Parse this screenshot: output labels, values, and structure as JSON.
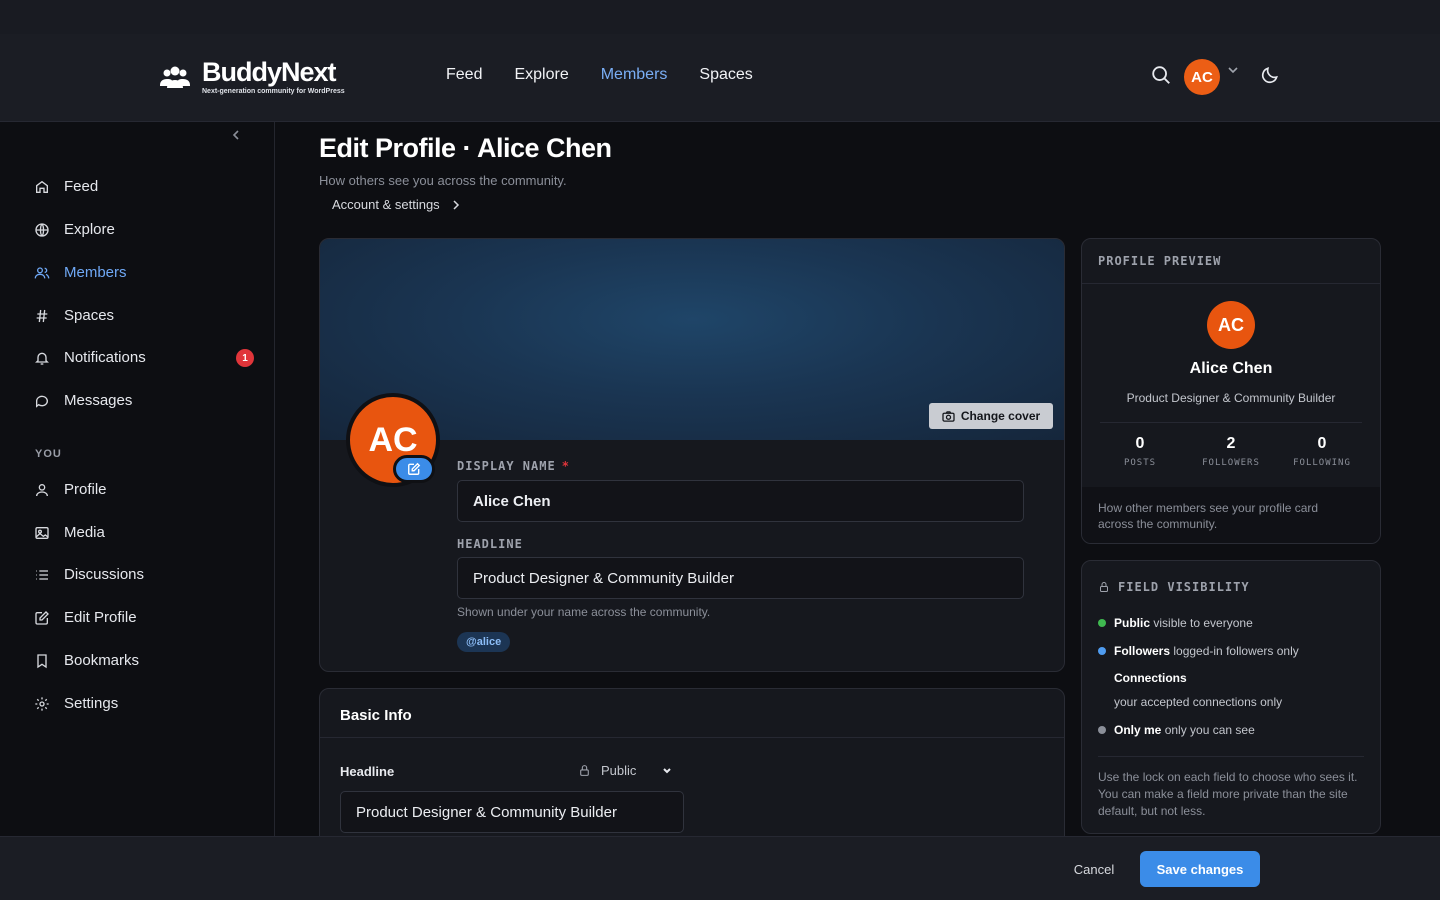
{
  "brand": {
    "name": "BuddyNext",
    "tagline": "Next-generation community for WordPress",
    "accent": "#3b8ce8",
    "avatar_color": "#e8550f"
  },
  "topnav": [
    {
      "label": "Feed",
      "active": false
    },
    {
      "label": "Explore",
      "active": false
    },
    {
      "label": "Members",
      "active": true
    },
    {
      "label": "Spaces",
      "active": false
    }
  ],
  "user": {
    "initials": "AC"
  },
  "sidebar": {
    "main": [
      {
        "label": "Feed",
        "icon": "home-icon"
      },
      {
        "label": "Explore",
        "icon": "globe-icon"
      },
      {
        "label": "Members",
        "icon": "users-icon",
        "active": true
      },
      {
        "label": "Spaces",
        "icon": "hash-icon"
      },
      {
        "label": "Notifications",
        "icon": "bell-icon",
        "badge": "1"
      },
      {
        "label": "Messages",
        "icon": "chat-icon"
      }
    ],
    "section_label": "YOU",
    "you": [
      {
        "label": "Profile",
        "icon": "user-icon"
      },
      {
        "label": "Media",
        "icon": "image-icon"
      },
      {
        "label": "Discussions",
        "icon": "list-icon"
      },
      {
        "label": "Edit Profile",
        "icon": "edit-icon"
      },
      {
        "label": "Bookmarks",
        "icon": "bookmark-icon"
      },
      {
        "label": "Settings",
        "icon": "gear-icon"
      }
    ]
  },
  "page": {
    "title": "Edit Profile · Alice Chen",
    "subtitle": "How others see you across the community.",
    "breadcrumb": "Account & settings"
  },
  "profile_card": {
    "change_cover": "Change cover",
    "initials": "AC",
    "display_name_label": "DISPLAY NAME",
    "required_mark": "*",
    "display_name": "Alice Chen",
    "headline_label": "HEADLINE",
    "headline": "Product Designer & Community Builder",
    "headline_hint": "Shown under your name across the community.",
    "handle": "@alice"
  },
  "basic_info": {
    "title": "Basic Info",
    "field_label": "Headline",
    "visibility": "Public",
    "value": "Product Designer & Community Builder"
  },
  "preview": {
    "label": "PROFILE PREVIEW",
    "initials": "AC",
    "name": "Alice Chen",
    "headline": "Product Designer & Community Builder",
    "stats": [
      {
        "num": "0",
        "label": "POSTS"
      },
      {
        "num": "2",
        "label": "FOLLOWERS"
      },
      {
        "num": "0",
        "label": "FOLLOWING"
      }
    ],
    "footer": "How other members see your profile card across the community."
  },
  "visibility": {
    "label": "FIELD VISIBILITY",
    "public_name": "Public",
    "public_desc": "visible to everyone",
    "followers_name": "Followers",
    "followers_desc": "logged-in followers only",
    "connections_name": "Connections",
    "connections_desc": "your accepted connections only",
    "onlyme_name": "Only me",
    "onlyme_desc": "only you can see",
    "note": "Use the lock on each field to choose who sees it. You can make a field more private than the site default, but not less.",
    "colors": {
      "public": "#3fb950",
      "followers": "#4f9cf0",
      "onlyme": "#8b8f99"
    }
  },
  "footer": {
    "cancel": "Cancel",
    "save": "Save changes"
  }
}
